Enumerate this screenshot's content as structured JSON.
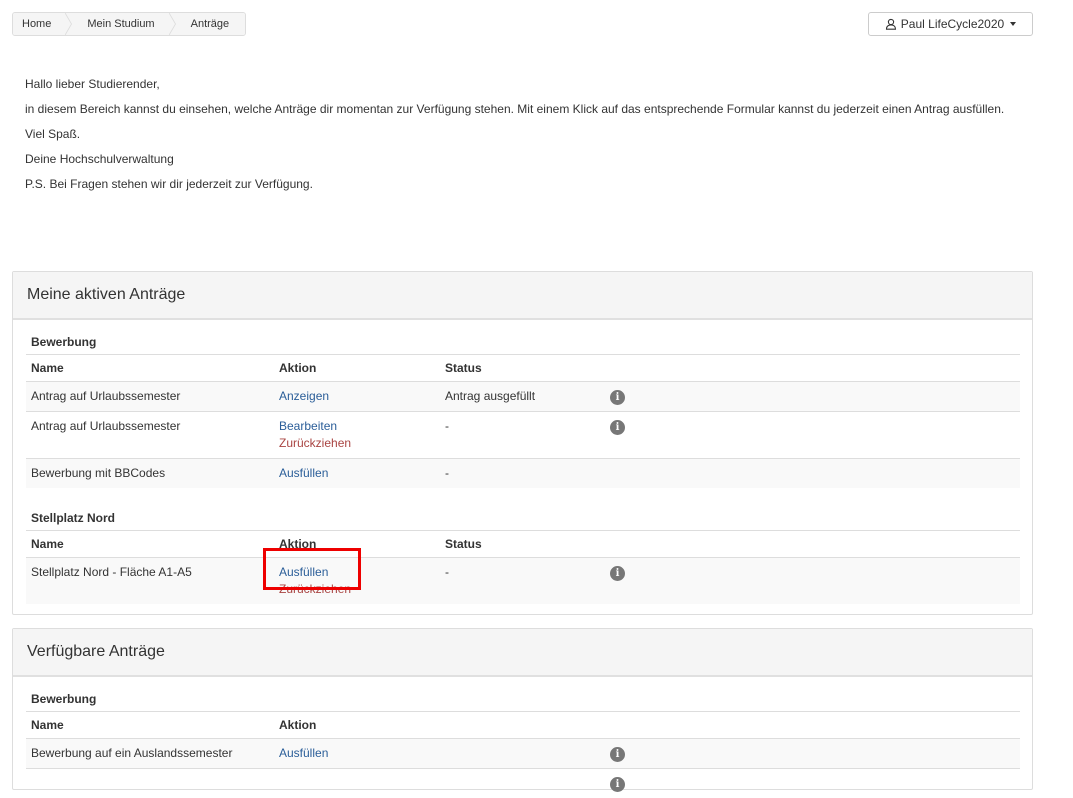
{
  "breadcrumb": [
    "Home",
    "Mein Studium",
    "Anträge"
  ],
  "user": {
    "name": "Paul LifeCycle2020",
    "icon": "user-icon"
  },
  "intro": [
    "Hallo lieber Studierender,",
    "in diesem Bereich kannst du einsehen, welche Anträge dir momentan zur Verfügung stehen. Mit einem Klick auf das entsprechende Formular kannst du jederzeit einen Antrag ausfüllen.",
    "Viel Spaß.",
    "Deine Hochschulverwaltung",
    "P.S. Bei Fragen stehen wir dir jederzeit zur Verfügung."
  ],
  "active": {
    "title": "Meine aktiven Anträge",
    "groups": [
      {
        "title": "Bewerbung",
        "headers": [
          "Name",
          "Aktion",
          "Status"
        ],
        "rows": [
          {
            "name": "Antrag auf Urlaubssemester",
            "actions": [
              "Anzeigen"
            ],
            "status": "Antrag ausgefüllt"
          },
          {
            "name": "Antrag auf Urlaubssemester",
            "actions": [
              "Bearbeiten",
              "Zurückziehen"
            ],
            "status": "-"
          },
          {
            "name": "Bewerbung mit BBCodes",
            "actions": [
              "Ausfüllen"
            ],
            "status": "-"
          }
        ]
      },
      {
        "title": "Stellplatz Nord",
        "headers": [
          "Name",
          "Aktion",
          "Status"
        ],
        "rows": [
          {
            "name": "Stellplatz Nord - Fläche A1-A5",
            "actions": [
              "Ausfüllen",
              "Zurückziehen"
            ],
            "status": "-"
          }
        ]
      }
    ]
  },
  "available": {
    "title": "Verfügbare Anträge",
    "groups": [
      {
        "title": "Bewerbung",
        "headers": [
          "Name",
          "Aktion"
        ],
        "rows": [
          {
            "name": "Bewerbung auf ein Auslandssemester",
            "actions": [
              "Ausfüllen"
            ]
          }
        ]
      }
    ]
  },
  "info_glyph": "i",
  "colors": {
    "link": "#2a5d98",
    "withdraw": "#a94442",
    "highlight": "#ee0000"
  }
}
